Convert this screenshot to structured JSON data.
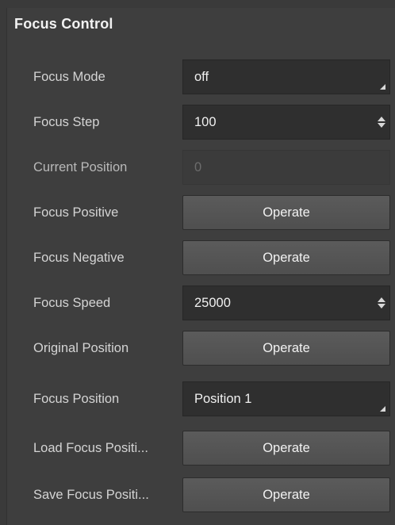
{
  "panel": {
    "title": "Focus Control"
  },
  "rows": {
    "focus_mode": {
      "label": "Focus Mode",
      "value": "off"
    },
    "focus_step": {
      "label": "Focus Step",
      "value": "100"
    },
    "current_position": {
      "label": "Current Position",
      "value": "0"
    },
    "focus_positive": {
      "label": "Focus Positive",
      "button": "Operate"
    },
    "focus_negative": {
      "label": "Focus Negative",
      "button": "Operate"
    },
    "focus_speed": {
      "label": "Focus Speed",
      "value": "25000"
    },
    "original_position": {
      "label": "Original Position",
      "button": "Operate"
    },
    "focus_position": {
      "label": "Focus Position",
      "value": "Position 1"
    },
    "load_focus_position": {
      "label": "Load Focus Positi...",
      "button": "Operate"
    },
    "save_focus_position": {
      "label": "Save Focus Positi...",
      "button": "Operate"
    }
  },
  "icons": {
    "dropdown": "dropdown-corner-arrow-icon",
    "spinner": "spinner-up-down-icon"
  },
  "colors": {
    "panel_bg": "#3e3e3e",
    "field_bg": "#2f2f2f",
    "button_bg": "#565656",
    "text": "#d4d4d4"
  }
}
